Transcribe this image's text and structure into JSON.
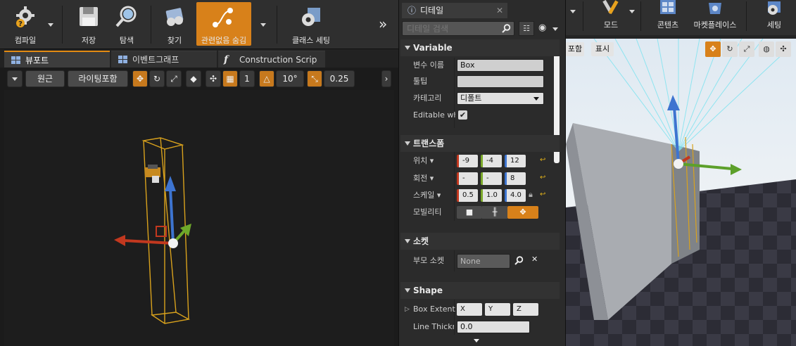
{
  "toolbar": {
    "compile_label": "컴파일",
    "save_label": "저장",
    "browse_label": "탐색",
    "find_label": "찾기",
    "hide_unrelated_label": "관련없음 숨김",
    "class_settings_label": "클래스 세팅"
  },
  "tabs": {
    "viewport": "뷰포트",
    "event_graph": "이벤트그래프",
    "construction_script": "Construction Scrip"
  },
  "viewport_toolbar": {
    "perspective": "원근",
    "lit": "라이팅포함",
    "grid_snap": "1",
    "rotation_snap": "10°",
    "scale_snap": "0.25"
  },
  "details": {
    "tab_title": "디테일",
    "search_placeholder": "디테일 검색",
    "variable": {
      "section": "Variable",
      "name_label": "변수 이름",
      "name_value": "Box",
      "tooltip_label": "툴팁",
      "tooltip_value": "",
      "category_label": "카테고리",
      "category_value": "디폴트",
      "editable_label": "Editable wh",
      "editable_checked": true
    },
    "transform": {
      "section": "트랜스폼",
      "location_label": "위치",
      "location": [
        "-9",
        "-4",
        "12"
      ],
      "rotation_label": "회전",
      "rotation": [
        "-",
        "-",
        "8"
      ],
      "scale_label": "스케일",
      "scale": [
        "0.5",
        "1.0",
        "4.0"
      ],
      "mobility_label": "모빌리티"
    },
    "sockets": {
      "section": "소켓",
      "parent_socket_label": "부모 소켓",
      "parent_socket_value": "None"
    },
    "shape": {
      "section": "Shape",
      "box_extent_label": "Box Extent",
      "box_extent": [
        "X",
        "Y",
        "Z"
      ],
      "line_thickness_label": "Line Thickn",
      "line_thickness_value": "0.0"
    }
  },
  "right_toolbar": {
    "modes_label": "모드",
    "content_label": "콘텐츠",
    "marketplace_label": "마켓플레이스",
    "settings_label": "세팅",
    "realtime_chip": "포함",
    "show_chip": "표시"
  },
  "colors": {
    "accent_orange": "#d8811a",
    "axis_x": "#c2381f",
    "axis_y": "#6ea82a",
    "axis_z": "#3d74d0",
    "bounds_yellow": "#d9a21d"
  }
}
